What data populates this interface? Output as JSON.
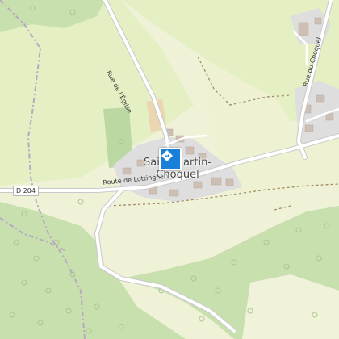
{
  "map": {
    "place": "Saint-Martin-Choquel",
    "place_lines": [
      "Saint-Martin-",
      "Choquel"
    ],
    "roads": {
      "route_shield": "D 204",
      "route_name": "Route de Lottinghen",
      "eglise": "Rue de l'Église",
      "choquel": "Rue du Choquel"
    },
    "marker_icon": "location-pin-icon",
    "colors": {
      "background": "#f0f2d8",
      "forest": "#c8dfae",
      "meadow": "#e4efc4",
      "built": "#dedede",
      "road": "#ffffff",
      "marker": "#1a7fd8"
    }
  }
}
